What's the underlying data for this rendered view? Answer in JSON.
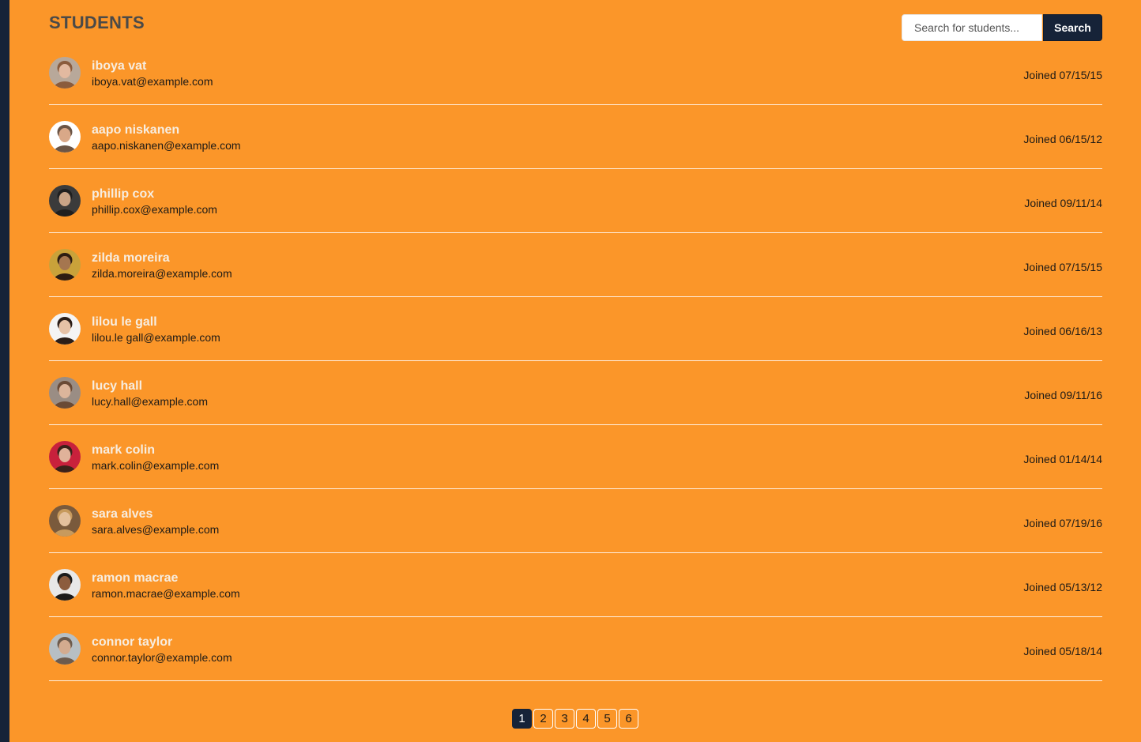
{
  "page_title": "STUDENTS",
  "search": {
    "placeholder": "Search for students...",
    "button_label": "Search"
  },
  "students": [
    {
      "name": "iboya vat",
      "email": "iboya.vat@example.com",
      "joined": "Joined 07/15/15",
      "avatar": {
        "bg": "#b8a89a",
        "skin": "#e2b9a0",
        "hair": "#8a5b3c"
      }
    },
    {
      "name": "aapo niskanen",
      "email": "aapo.niskanen@example.com",
      "joined": "Joined 06/15/12",
      "avatar": {
        "bg": "#ffffff",
        "skin": "#d9a888",
        "hair": "#6b5546"
      }
    },
    {
      "name": "phillip cox",
      "email": "phillip.cox@example.com",
      "joined": "Joined 09/11/14",
      "avatar": {
        "bg": "#3b3b3b",
        "skin": "#c9a487",
        "hair": "#1f1f1f"
      }
    },
    {
      "name": "zilda moreira",
      "email": "zilda.moreira@example.com",
      "joined": "Joined 07/15/15",
      "avatar": {
        "bg": "#c9a23a",
        "skin": "#a5764f",
        "hair": "#2c1d12"
      }
    },
    {
      "name": "lilou le gall",
      "email": "lilou.le gall@example.com",
      "joined": "Joined 06/16/13",
      "avatar": {
        "bg": "#f4f4f4",
        "skin": "#e6c2a6",
        "hair": "#2b1e18"
      }
    },
    {
      "name": "lucy hall",
      "email": "lucy.hall@example.com",
      "joined": "Joined 09/11/16",
      "avatar": {
        "bg": "#9a8d84",
        "skin": "#dcb59b",
        "hair": "#6a4a35"
      }
    },
    {
      "name": "mark colin",
      "email": "mark.colin@example.com",
      "joined": "Joined 01/14/14",
      "avatar": {
        "bg": "#c8213c",
        "skin": "#e0b29a",
        "hair": "#3a221a"
      }
    },
    {
      "name": "sara alves",
      "email": "sara.alves@example.com",
      "joined": "Joined 07/19/16",
      "avatar": {
        "bg": "#7a5a3c",
        "skin": "#e4c09c",
        "hair": "#c79a5d"
      }
    },
    {
      "name": "ramon macrae",
      "email": "ramon.macrae@example.com",
      "joined": "Joined 05/13/12",
      "avatar": {
        "bg": "#e8e8e8",
        "skin": "#8c5c3e",
        "hair": "#1b1b1b"
      }
    },
    {
      "name": "connor taylor",
      "email": "connor.taylor@example.com",
      "joined": "Joined 05/18/14",
      "avatar": {
        "bg": "#b7bfc4",
        "skin": "#d3ab8f",
        "hair": "#6d5b4d"
      }
    }
  ],
  "pagination": {
    "pages": [
      "1",
      "2",
      "3",
      "4",
      "5",
      "6"
    ],
    "current": "1"
  },
  "colors": {
    "background": "#fb9629",
    "accent_dark": "#162338",
    "divider": "#ffffff"
  }
}
